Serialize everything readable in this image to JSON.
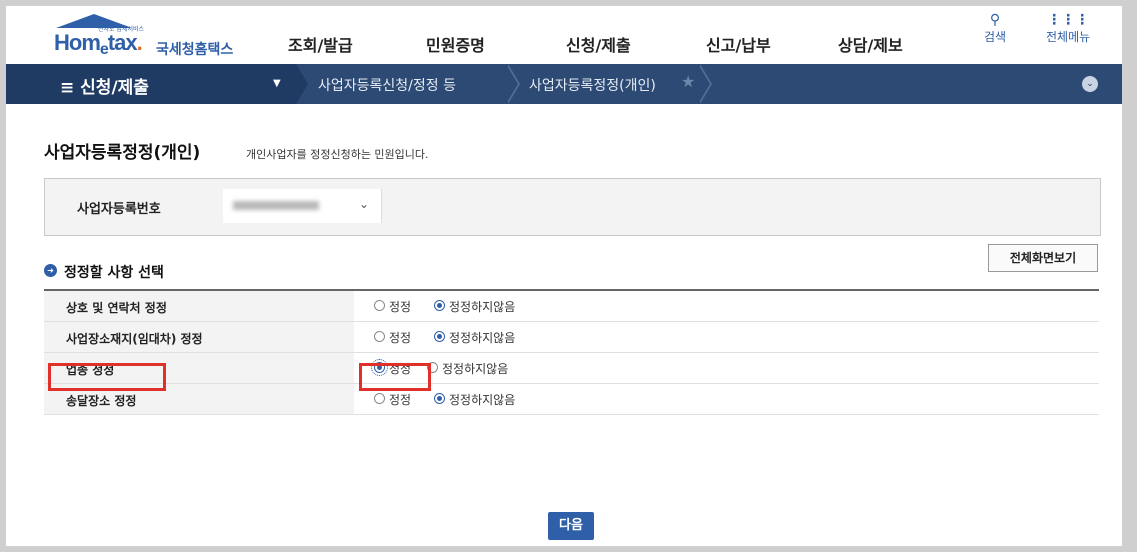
{
  "header": {
    "logo": {
      "tagline": "전자로 납세서비스",
      "brand_home": "Hom",
      "brand_e": "e",
      "brand_tax": "tax",
      "brand_dot": ".",
      "brand_kr": "국세청홈택스"
    },
    "gnb": [
      "조회/발급",
      "민원증명",
      "신청/제출",
      "신고/납부",
      "상담/제보"
    ],
    "search_label": "검색",
    "allmenu_label": "전체메뉴",
    "search_icon": "search-icon",
    "allmenu_icon": "grid-icon"
  },
  "navbar": {
    "menu_label": "≡  신청/제출",
    "dropdown_glyph": "▼",
    "crumbs": [
      "사업자등록신청/정정 등",
      "사업자등록정정(개인)"
    ],
    "star_glyph": "★",
    "circle_glyph": "⌄"
  },
  "page": {
    "title": "사업자등록정정(개인)",
    "description": "개인사업자를 정정신청하는 민원입니다.",
    "reg_label": "사업자등록번호",
    "reg_caret": "⌄",
    "section_title": "정정할 사항 선택",
    "fullview_label": "전체화면보기",
    "next_label": "다음"
  },
  "options": {
    "opt_a": "정정",
    "opt_b": "정정하지않음",
    "rows": [
      {
        "label": "상호 및 연락처 정정",
        "selected": "정정하지않음"
      },
      {
        "label": "사업장소재지(임대차) 정정",
        "selected": "정정하지않음"
      },
      {
        "label": "업종 정정",
        "selected": "정정"
      },
      {
        "label": "송달장소 정정",
        "selected": "정정하지않음"
      }
    ]
  },
  "colors": {
    "brand": "#2f5fa8",
    "navbar": "#2c4a74",
    "highlight": "#e0302a"
  }
}
